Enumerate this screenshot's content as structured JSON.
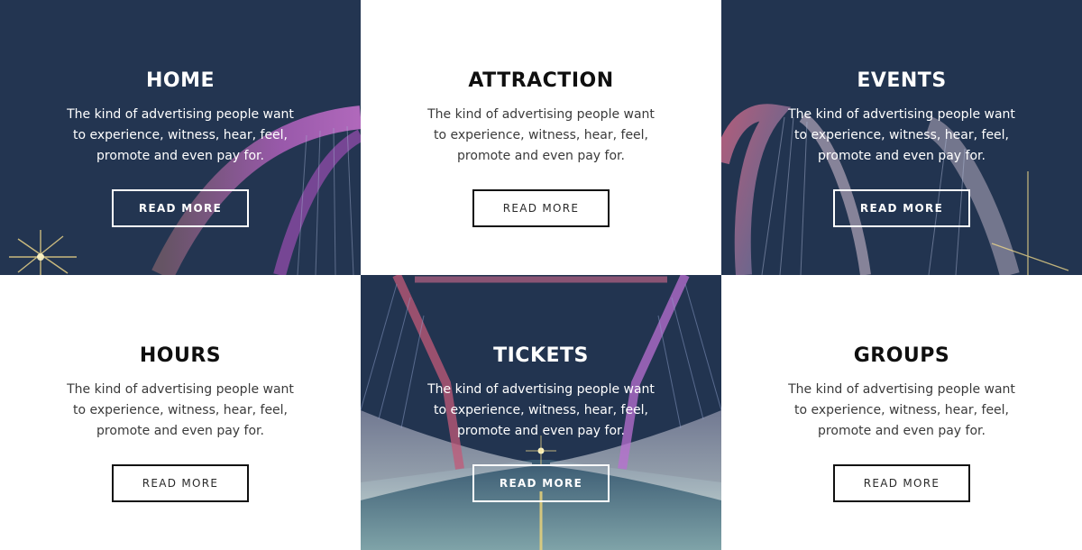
{
  "tiles": [
    {
      "title": "HOME",
      "description": "The kind of advertising people want to experience, witness, hear, feel, promote and even pay for.",
      "button_label": "READ MORE",
      "theme": "dark"
    },
    {
      "title": "ATTRACTION",
      "description": "The kind of advertising people want to experience, witness, hear, feel, promote and even pay for.",
      "button_label": "READ MORE",
      "theme": "light"
    },
    {
      "title": "EVENTS",
      "description": "The kind of advertising people want to experience, witness, hear, feel, promote and even pay for.",
      "button_label": "READ MORE",
      "theme": "dark"
    },
    {
      "title": "HOURS",
      "description": "The kind of advertising people want to experience, witness, hear, feel, promote and even pay for.",
      "button_label": "READ MORE",
      "theme": "light"
    },
    {
      "title": "TICKETS",
      "description": "The kind of advertising people want to experience, witness, hear, feel, promote and even pay for.",
      "button_label": "READ MORE",
      "theme": "dark"
    },
    {
      "title": "GROUPS",
      "description": "The kind of advertising people want to experience, witness, hear, feel, promote and even pay for.",
      "button_label": "READ MORE",
      "theme": "light"
    }
  ],
  "colors": {
    "overlay_navy": "#223450",
    "light_bg": "#ffffff",
    "dark_text": "#0f0f0f"
  }
}
